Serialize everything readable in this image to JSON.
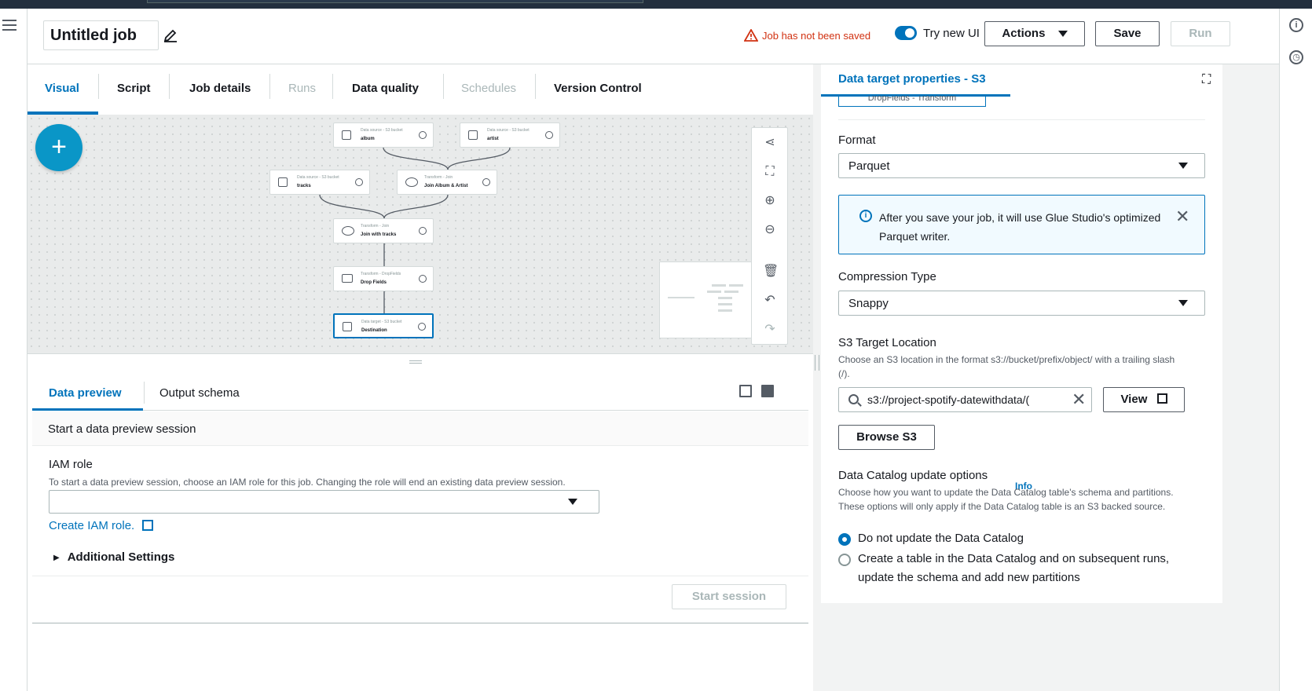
{
  "header": {
    "job_name": "Untitled job",
    "unsaved_warning": "Job has not been saved",
    "try_new_ui_label": "Try new UI",
    "actions_label": "Actions",
    "save_label": "Save",
    "run_label": "Run"
  },
  "tabs": [
    {
      "label": "Visual",
      "state": "active"
    },
    {
      "label": "Script",
      "state": "enabled"
    },
    {
      "label": "Job details",
      "state": "enabled"
    },
    {
      "label": "Runs",
      "state": "disabled"
    },
    {
      "label": "Data quality",
      "state": "enabled"
    },
    {
      "label": "Schedules",
      "state": "disabled"
    },
    {
      "label": "Version Control",
      "state": "enabled"
    }
  ],
  "canvas": {
    "nodes": [
      {
        "type_label": "Data source - S3 bucket",
        "name": "album"
      },
      {
        "type_label": "Data source - S3 bucket",
        "name": "artist"
      },
      {
        "type_label": "Data source - S3 bucket",
        "name": "tracks"
      },
      {
        "type_label": "Transform - Join",
        "name": "Join Album & Artist"
      },
      {
        "type_label": "Transform - Join",
        "name": "Join with tracks"
      },
      {
        "type_label": "Transform - DropFields",
        "name": "Drop Fields"
      },
      {
        "type_label": "Data target - S3 bucket",
        "name": "Destination"
      }
    ]
  },
  "bottom_panel": {
    "tabs": {
      "data_preview": "Data preview",
      "output_schema": "Output schema"
    },
    "session_heading": "Start a data preview session",
    "iam_role_label": "IAM role",
    "iam_role_description": "To start a data preview session, choose an IAM role for this job. Changing the role will end an existing data preview session.",
    "create_iam_role": "Create IAM role.",
    "additional_settings": "Additional Settings",
    "start_session": "Start session"
  },
  "right_panel": {
    "title": "Data target properties - S3",
    "parent_chip": "DropFields - Transform",
    "format_label": "Format",
    "format_value": "Parquet",
    "alert_text": "After you save your job, it will use Glue Studio's optimized Parquet writer.",
    "compression_label": "Compression Type",
    "compression_value": "Snappy",
    "s3_location_label": "S3 Target Location",
    "s3_location_description": "Choose an S3 location in the format s3://bucket/prefix/object/ with a trailing slash (/).",
    "s3_location_value": "s3://project-spotify-datewithdata/(",
    "view_label": "View",
    "browse_label": "Browse S3",
    "catalog_label": "Data Catalog update options",
    "catalog_info": "Info",
    "catalog_description": "Choose how you want to update the Data Catalog table's schema and partitions. These options will only apply if the Data Catalog table is an S3 backed source.",
    "catalog_options": [
      {
        "label": "Do not update the Data Catalog",
        "selected": true
      },
      {
        "label": "Create a table in the Data Catalog and on subsequent runs, update the schema and add new partitions",
        "selected": false
      }
    ]
  },
  "colors": {
    "accent": "#0073bb",
    "warning": "#d13212",
    "add_button": "#0a96c7"
  }
}
